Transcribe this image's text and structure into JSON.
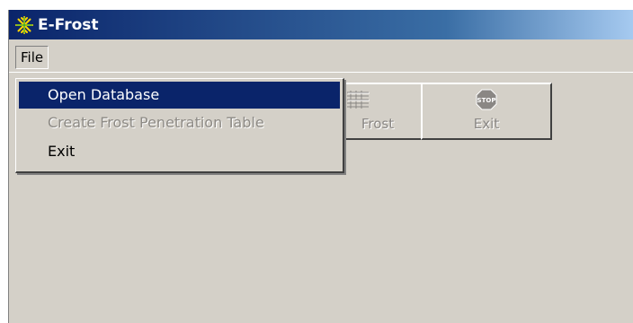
{
  "window": {
    "title": "E-Frost",
    "title_icon": "snowflake-icon",
    "titlebar_color": "#0a246a"
  },
  "menubar": {
    "file_label": "File"
  },
  "file_menu": {
    "items": [
      {
        "label": "Open Database",
        "state": "selected"
      },
      {
        "label": "Create Frost Penetration Table",
        "state": "disabled"
      },
      {
        "label": "Exit",
        "state": "normal"
      }
    ]
  },
  "toolbar": {
    "buttons": [
      {
        "label": "Frost",
        "icon": "table-icon",
        "state": "disabled"
      },
      {
        "label": "Exit",
        "icon": "stop-sign-icon",
        "state": "disabled"
      }
    ]
  },
  "colors": {
    "face": "#d4d0c8",
    "highlight": "#0a246a",
    "disabled_text": "#8d8a85"
  }
}
